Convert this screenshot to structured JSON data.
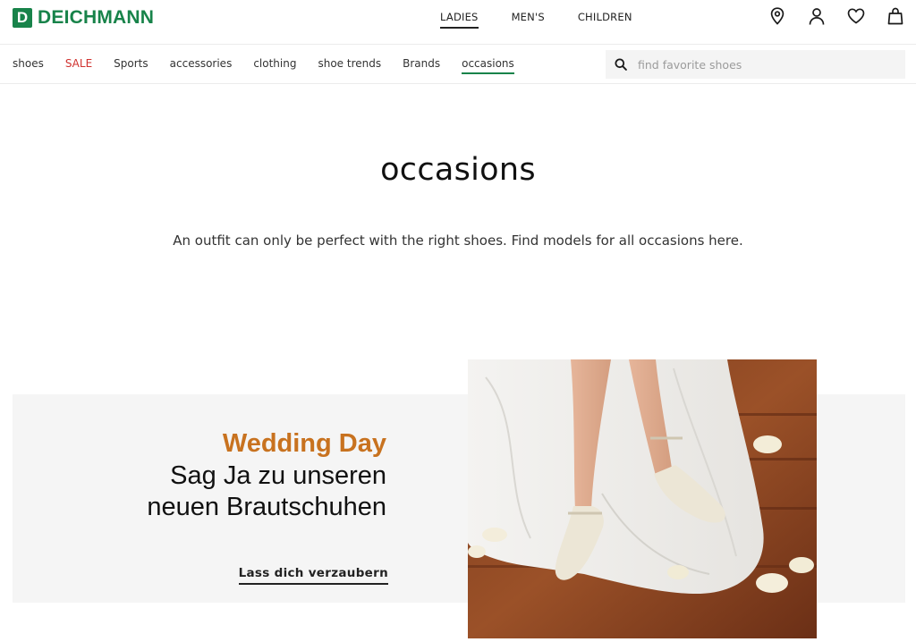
{
  "header": {
    "logo_letter": "D",
    "logo_text": "DEICHMANN",
    "brand_color": "#18834a",
    "gender_nav": [
      {
        "label": "LADIES",
        "active": true
      },
      {
        "label": "MEN'S",
        "active": false
      },
      {
        "label": "CHILDREN",
        "active": false
      }
    ],
    "icons": [
      "location-pin-icon",
      "user-account-icon",
      "wishlist-heart-icon",
      "shopping-bag-icon"
    ]
  },
  "category_nav": {
    "items": [
      {
        "label": "shoes"
      },
      {
        "label": "SALE",
        "highlight": "#d0322f"
      },
      {
        "label": "Sports"
      },
      {
        "label": "accessories"
      },
      {
        "label": "clothing"
      },
      {
        "label": "shoe trends"
      },
      {
        "label": "Brands"
      },
      {
        "label": "occasions",
        "active": true
      }
    ],
    "active_underline_color": "#18834a"
  },
  "search": {
    "placeholder": "find favorite shoes",
    "icon": "search-icon"
  },
  "main": {
    "title": "occasions",
    "intro": "An outfit can only be perfect with the right shoes. Find models for all occasions here."
  },
  "teaser": {
    "kicker": "Wedding Day",
    "kicker_color": "#c8721f",
    "headline": "Sag Ja zu unseren\nneuen Brautschuhen",
    "cta": "Lass dich verzaubern",
    "image": "bridal-shoes-photo"
  }
}
